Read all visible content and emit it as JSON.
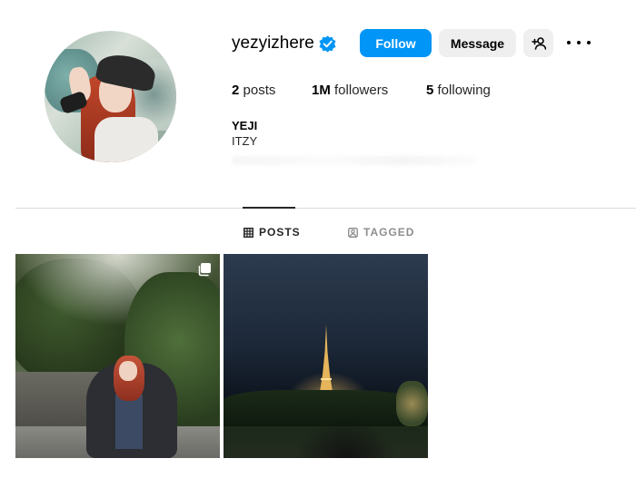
{
  "profile": {
    "username": "yezyizhere",
    "verified_icon": "verified-badge-icon",
    "full_name": "YEJI",
    "bio": "ITZY"
  },
  "actions": {
    "follow_label": "Follow",
    "message_label": "Message",
    "add_user_icon": "add-user-icon",
    "more_icon": "more-options-icon"
  },
  "stats": {
    "posts_count": "2",
    "posts_label": "posts",
    "followers_count": "1M",
    "followers_label": "followers",
    "following_count": "5",
    "following_label": "following"
  },
  "tabs": [
    {
      "label": "POSTS",
      "icon": "grid-icon",
      "active": true
    },
    {
      "label": "TAGGED",
      "icon": "tagged-icon",
      "active": false
    }
  ],
  "posts": [
    {
      "type": "carousel",
      "icon": "carousel-icon"
    },
    {
      "type": "image"
    }
  ],
  "colors": {
    "accent": "#0095f6",
    "button_secondary": "#efefef",
    "text": "#262626",
    "muted": "#8e8e8e",
    "divider": "#dbdbdb"
  }
}
